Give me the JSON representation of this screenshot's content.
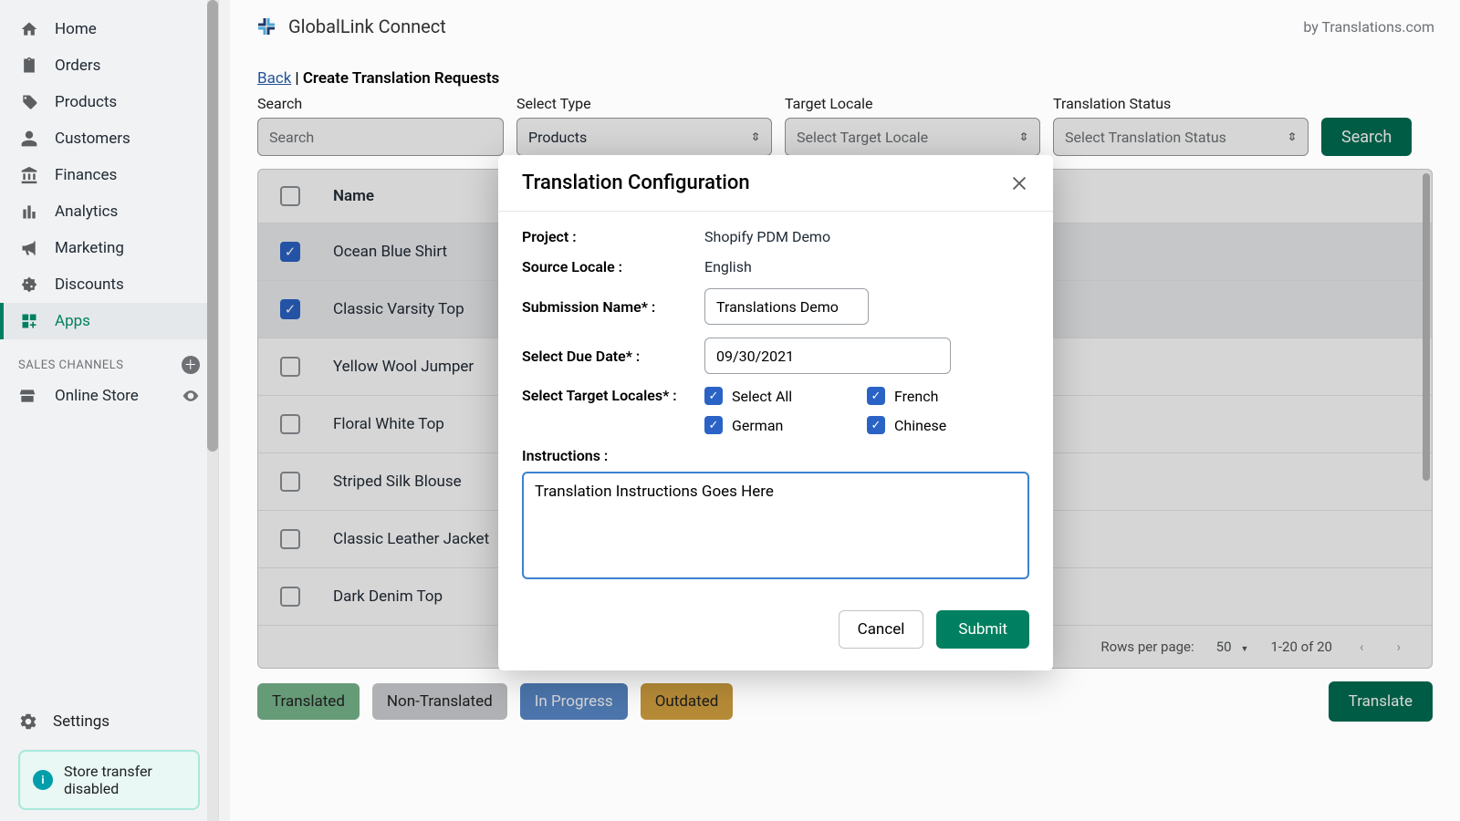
{
  "sidebar": {
    "nav": [
      {
        "label": "Home"
      },
      {
        "label": "Orders"
      },
      {
        "label": "Products"
      },
      {
        "label": "Customers"
      },
      {
        "label": "Finances"
      },
      {
        "label": "Analytics"
      },
      {
        "label": "Marketing"
      },
      {
        "label": "Discounts"
      },
      {
        "label": "Apps"
      }
    ],
    "sales_channels_label": "SALES CHANNELS",
    "online_store_label": "Online Store",
    "settings_label": "Settings",
    "banner_text": "Store transfer disabled"
  },
  "header": {
    "app_title": "GlobalLink Connect",
    "byline": "by Translations.com"
  },
  "breadcrumb": {
    "back": "Back",
    "title": "Create Translation Requests"
  },
  "filters": {
    "search_label": "Search",
    "search_placeholder": "Search",
    "type_label": "Select Type",
    "type_value": "Products",
    "locale_label": "Target Locale",
    "locale_value": "Select Target Locale",
    "status_label": "Translation Status",
    "status_value": "Select Translation Status",
    "search_button": "Search"
  },
  "table": {
    "header_name": "Name",
    "rows": [
      {
        "name": "Ocean Blue Shirt",
        "selected": true
      },
      {
        "name": "Classic Varsity Top",
        "selected": true
      },
      {
        "name": "Yellow Wool Jumper",
        "selected": false
      },
      {
        "name": "Floral White Top",
        "selected": false
      },
      {
        "name": "Striped Silk Blouse",
        "selected": false
      },
      {
        "name": "Classic Leather Jacket",
        "selected": false
      },
      {
        "name": "Dark Denim Top",
        "selected": false
      }
    ],
    "rows_per_page_label": "Rows per page:",
    "rows_per_page_value": "50",
    "range_text": "1-20 of 20"
  },
  "legend": {
    "translated": "Translated",
    "non_translated": "Non-Translated",
    "in_progress": "In Progress",
    "outdated": "Outdated",
    "translate_button": "Translate"
  },
  "modal": {
    "title": "Translation Configuration",
    "project_label": "Project :",
    "project_value": "Shopify PDM Demo",
    "source_label": "Source Locale :",
    "source_value": "English",
    "submission_label": "Submission Name* :",
    "submission_value": "Translations Demo",
    "due_label": "Select Due Date* :",
    "due_value": "09/30/2021",
    "locales_label": "Select Target Locales* :",
    "locales": [
      {
        "label": "Select All"
      },
      {
        "label": "French"
      },
      {
        "label": "German"
      },
      {
        "label": "Chinese"
      }
    ],
    "instructions_label": "Instructions :",
    "instructions_value": "Translation Instructions Goes Here",
    "cancel": "Cancel",
    "submit": "Submit"
  }
}
